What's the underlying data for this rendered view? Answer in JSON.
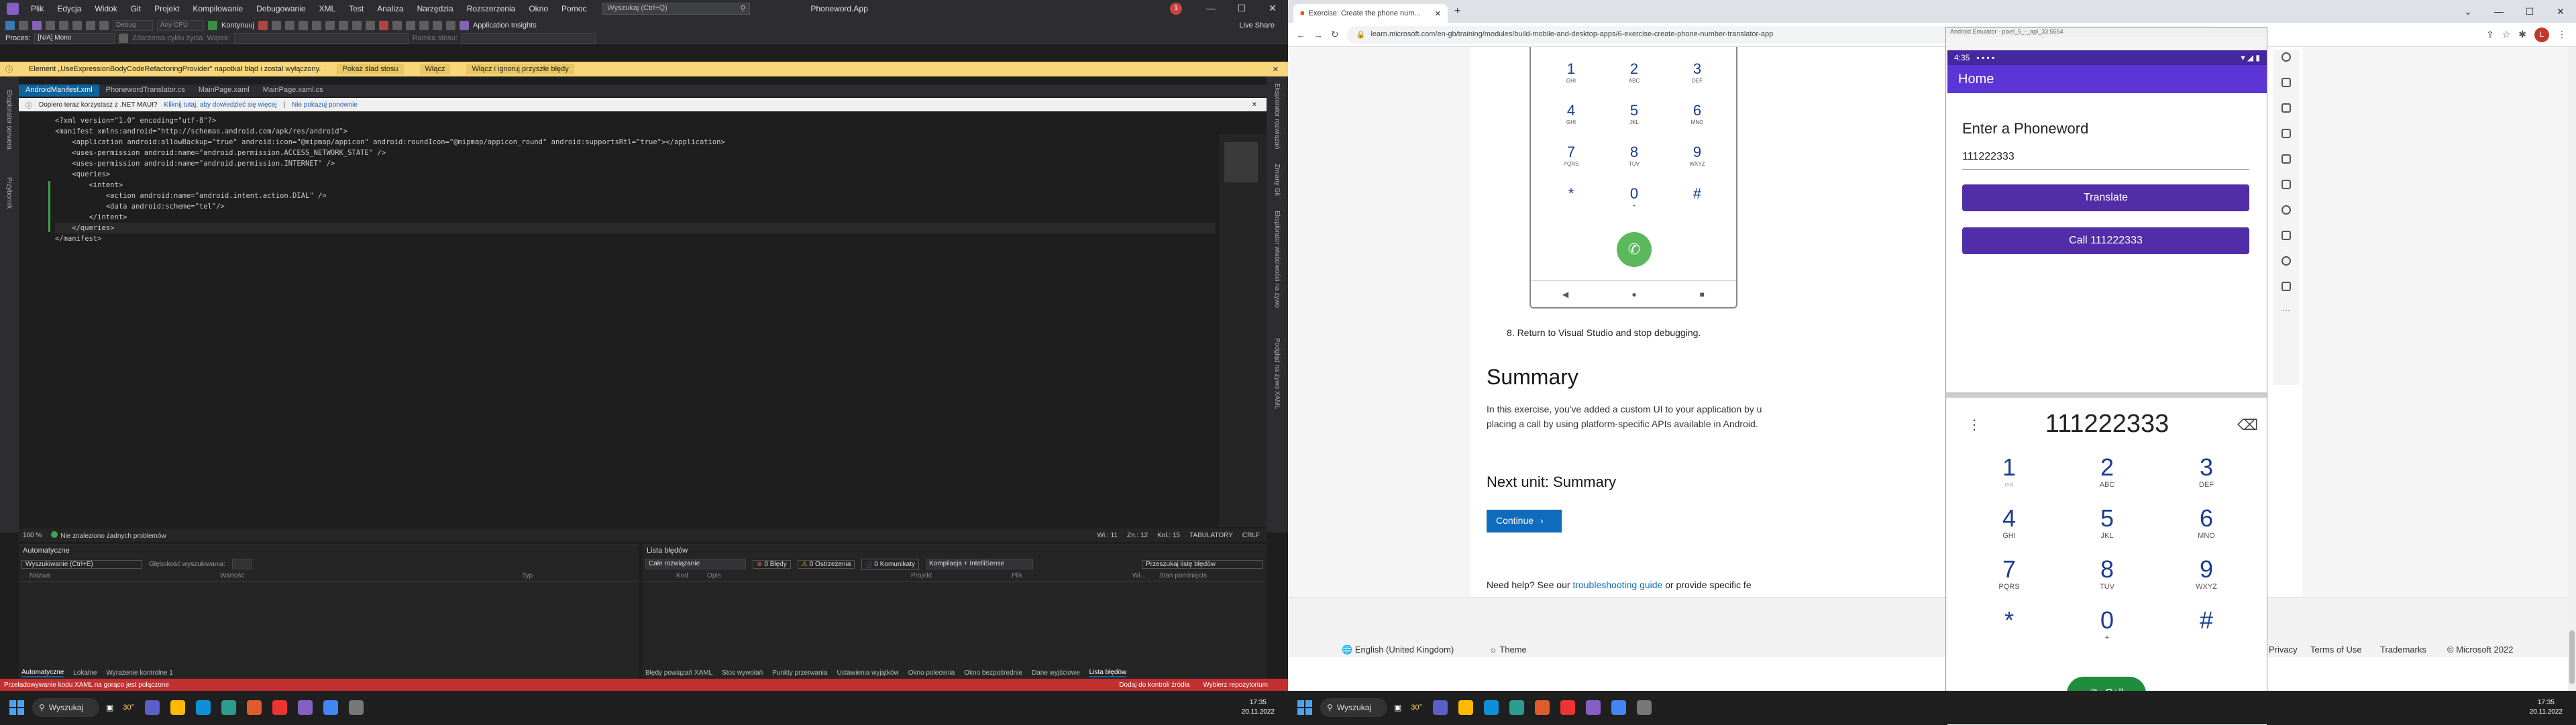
{
  "vs": {
    "menu": [
      "Plik",
      "Edycja",
      "Widok",
      "Git",
      "Projekt",
      "Kompilowanie",
      "Debugowanie",
      "XML",
      "Test",
      "Analiza",
      "Narzędzia",
      "Rozszerzenia",
      "Okno",
      "Pomoc"
    ],
    "search_label": "Wyszukaj (Ctrl+Q)",
    "app_title": "Phoneword.App",
    "badge": "1",
    "toolbar": {
      "config": "Debug",
      "platform": "Any CPU",
      "run_label": "Kontynuuj",
      "app_insights": "Application Insights",
      "live_share": "Live Share",
      "process_label": "Proces:",
      "process_value": "[N/A] Mono",
      "lifecycle": "Zdarzenia cyklu życia",
      "thread": "Wątek:",
      "stack": "Ramka stosu:"
    },
    "info_bar": {
      "message": "Element „UseExpressionBodyCodeRefactoringProvider\" napotkał błąd i został wyłączony.",
      "btn_show": "Pokaż ślad stosu",
      "btn_enable": "Włącz",
      "btn_enable_ignore": "Włącz i ignoruj przyszłe błędy"
    },
    "tabs": [
      "AndroidManifest.xml",
      "PhonewordTranslator.cs",
      "MainPage.xaml",
      "MainPage.xaml.cs"
    ],
    "net_bar": {
      "message": "Dopiero teraz korzystasz z .NET MAUI?",
      "link1": "Kliknij tutaj, aby dowiedzieć się więcej",
      "sep": "|",
      "link2": "Nie pokazuj ponownie"
    },
    "code": [
      "<?xml version=\"1.0\" encoding=\"utf-8\"?>",
      "<manifest xmlns:android=\"http://schemas.android.com/apk/res/android\">",
      "    <application android:allowBackup=\"true\" android:icon=\"@mipmap/appicon\" android:roundIcon=\"@mipmap/appicon_round\" android:supportsRtl=\"true\"></application>",
      "    <uses-permission android:name=\"android.permission.ACCESS_NETWORK_STATE\" />",
      "    <uses-permission android:name=\"android.permission.INTERNET\" />",
      "    <queries>",
      "        <intent>",
      "            <action android:name=\"android.intent.action.DIAL\" />",
      "            <data android:scheme=\"tel\"/>",
      "        </intent>",
      "    </queries>",
      "</manifest>"
    ],
    "editor_status": {
      "zoom": "100 %",
      "issues": "Nie znaleziono żadnych problemów",
      "line": "Wi.: 11",
      "col": "Zn.: 12",
      "pos": "Kol.: 15",
      "tabs": "TABULATORY",
      "eol": "CRLF"
    },
    "autos": {
      "title": "Automatyczne",
      "search": "Wyszukiwanie (Ctrl+E)",
      "depth": "Głębokość wyszukiwania:",
      "cols": [
        "Nazwa",
        "Wartość",
        "Typ"
      ],
      "bottom_tabs": [
        "Automatyczne",
        "Lokalne",
        "Wyrażenie kontrolne 1"
      ]
    },
    "errors": {
      "title": "Lista błędów",
      "scope": "Całe rozwiązanie",
      "errors": "0 Błędy",
      "warnings": "0 Ostrzeżenia",
      "messages": "0 Komunikaty",
      "build": "Kompilacja + IntelliSense",
      "search": "Przeszukaj listę błędów",
      "cols": [
        "Kod",
        "Opis",
        "Projekt",
        "Plik",
        "Wi...",
        "Stan pominięcia"
      ],
      "bottom_tabs": [
        "Błędy powiązań XAML",
        "Stos wywołań",
        "Punkty przerwania",
        "Ustawienia wyjątków",
        "Okno polecenia",
        "Okno bezpośrednie",
        "Dane wyjściowe",
        "Lista błędów"
      ]
    },
    "side_left": [
      "Eksplorator serwera",
      "Przybornik"
    ],
    "side_right": [
      "Eksplorator rozwiązań",
      "Zmiany Git",
      "Eksplorator właściwości na żywo",
      "Podgląd na żywo XAML"
    ],
    "statusbar": {
      "left": "Przeładowywanie kodu XAML na gorąco jest połączone",
      "source": "Dodaj do kontroli źródła",
      "repo": "Wybierz repozytorium"
    }
  },
  "browser": {
    "tab_title": "Exercise: Create the phone num...",
    "url": "learn.microsoft.com/en-gb/training/modules/build-mobile-and-desktop-apps/6-exercise-create-phone-number-translator-app",
    "profile": "L",
    "doc_keypad": [
      [
        "1",
        "GHI"
      ],
      [
        "2",
        "ABC"
      ],
      [
        "3",
        "DEF"
      ],
      [
        "4",
        "GHI"
      ],
      [
        "5",
        "JKL"
      ],
      [
        "6",
        "MNO"
      ],
      [
        "7",
        "PQRS"
      ],
      [
        "8",
        "TUV"
      ],
      [
        "9",
        "WXYZ"
      ],
      [
        "*",
        ""
      ],
      [
        "0",
        "+"
      ],
      [
        "#",
        ""
      ]
    ],
    "step8": "8.  Return to Visual Studio and stop debugging.",
    "summary_title": "Summary",
    "summary_text_1": "In this exercise, you've added a custom UI to your application by u",
    "summary_text_2": "placing a call by using platform-specific APIs available in Android.",
    "next_unit": "Next unit: Summary",
    "continue": "Continue",
    "help": "Need help? See our",
    "help_link": "troubleshooting guide",
    "help_rest": "or provide specific fe",
    "footer": {
      "lang": "English (United Kingdom)",
      "theme": "Theme",
      "privacy": "Privacy",
      "terms": "Terms of Use",
      "trademarks": "Trademarks",
      "copyright": "© Microsoft 2022"
    }
  },
  "emulator": {
    "title": "Android Emulator - pixel_5_-_api_33:5554",
    "time": "4:35",
    "appbar": "Home",
    "heading": "Enter a Phoneword",
    "input": "111222333",
    "translate": "Translate",
    "call_btn": "Call 111222333",
    "dial_number": "111222333",
    "keys": [
      [
        "1",
        "○○"
      ],
      [
        "2",
        "ABC"
      ],
      [
        "3",
        "DEF"
      ],
      [
        "4",
        "GHI"
      ],
      [
        "5",
        "JKL"
      ],
      [
        "6",
        "MNO"
      ],
      [
        "7",
        "PQRS"
      ],
      [
        "8",
        "TUV"
      ],
      [
        "9",
        "WXYZ"
      ],
      [
        "*",
        ""
      ],
      [
        "0",
        "+"
      ],
      [
        "#",
        ""
      ]
    ],
    "call": "Call"
  },
  "taskbar": {
    "search": "Wyszukaj",
    "weather": "30°",
    "time": "17:35",
    "date": "20.11.2022",
    "time2": "17:35",
    "date2": "20.11.2022"
  }
}
